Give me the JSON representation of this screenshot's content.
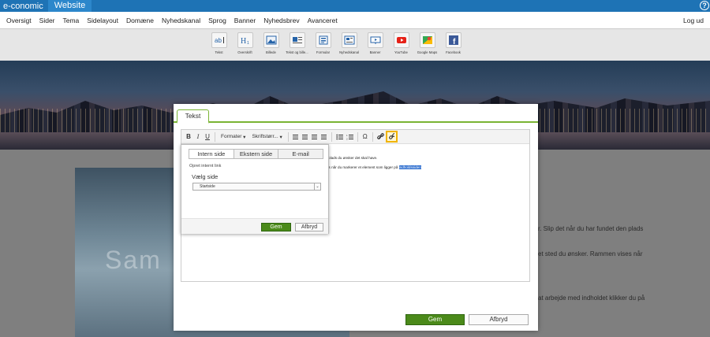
{
  "topbar": {
    "brand": "e-conomic",
    "active_tab": "Website"
  },
  "menu": {
    "items": [
      "Oversigt",
      "Sider",
      "Tema",
      "Sidelayout",
      "Domæne",
      "Nyhedskanal",
      "Sprog",
      "Banner",
      "Nyhedsbrev",
      "Avanceret"
    ],
    "logout": "Log ud"
  },
  "widgets": [
    {
      "label": "Tekst",
      "icon": "text-icon"
    },
    {
      "label": "Overskrift",
      "icon": "heading-icon"
    },
    {
      "label": "Billede",
      "icon": "image-icon"
    },
    {
      "label": "Tekst og bille...",
      "icon": "text-image-icon"
    },
    {
      "label": "Formular",
      "icon": "form-icon"
    },
    {
      "label": "Nyhedskanal",
      "icon": "newsfeed-icon"
    },
    {
      "label": "Banner",
      "icon": "banner-icon"
    },
    {
      "label": "YouTube",
      "icon": "youtube-icon"
    },
    {
      "label": "Google Maps",
      "icon": "google-maps-icon"
    },
    {
      "label": "Facebook",
      "icon": "facebook-icon"
    }
  ],
  "background": {
    "photo_text": "Sam",
    "side_lines": [
      "r. Slip det når du har fundet den plads",
      "et sted du ønsker. Rammen vises når",
      "at arbejde med indholdet klikker du på"
    ]
  },
  "modal": {
    "tab": "Tekst",
    "toolbar": {
      "bold": "B",
      "italic": "I",
      "underline": "U",
      "formats": "Formater",
      "font_size": "Skriftstørr...",
      "omega": "Ω"
    },
    "editor_lines": {
      "line1": "et den plads du ønsker det skal have.",
      "line2_before": "en vises når du markerer et element som ligger på ",
      "line2_selected": "indholdssiden"
    },
    "save": "Gem",
    "cancel": "Afbryd"
  },
  "link_popup": {
    "tabs": [
      "Intern side",
      "Ekstern side",
      "E-mail"
    ],
    "title": "Opret internt link",
    "select_label": "Vælg side",
    "select_value": "Startside",
    "save": "Gem",
    "cancel": "Afbryd"
  },
  "colors": {
    "topbar": "#1e73b5",
    "accent_green": "#4b8a1a",
    "tab_border": "#7ab433",
    "highlight": "#f0b400"
  }
}
